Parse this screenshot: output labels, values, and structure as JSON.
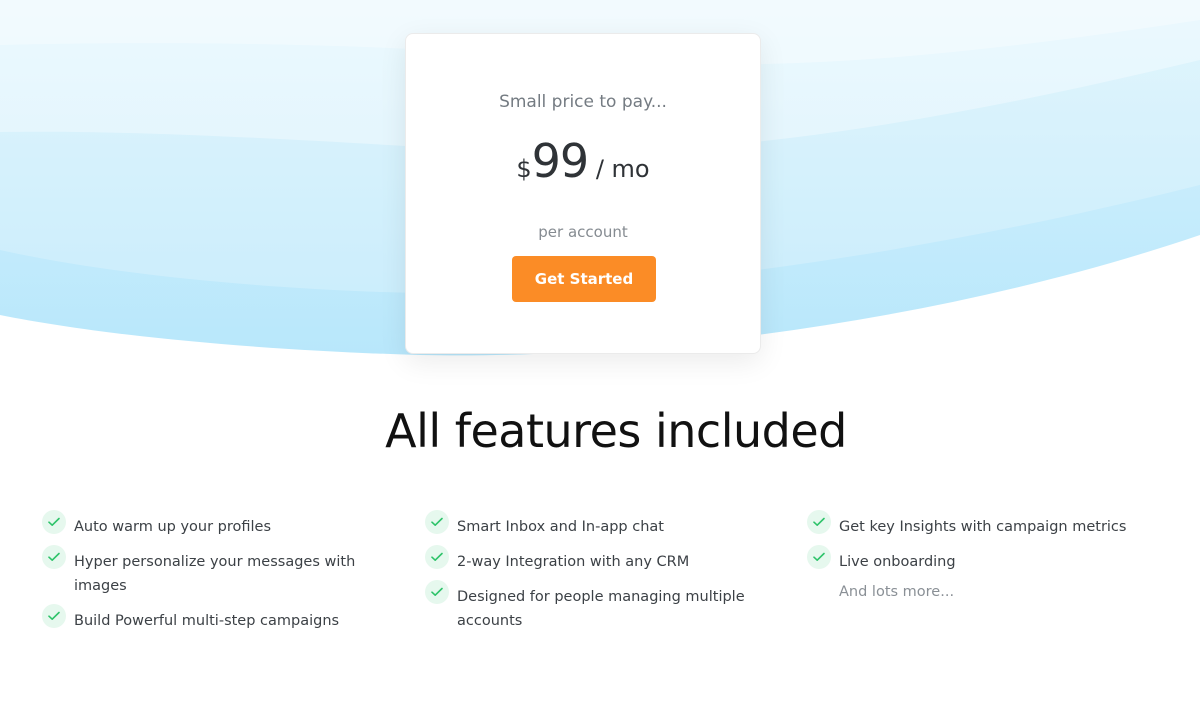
{
  "pricing": {
    "tagline": "Small price to pay...",
    "currency": "$",
    "amount": "99",
    "period": " / mo",
    "subtext": "per account",
    "cta_label": "Get Started"
  },
  "features": {
    "title": "All features included",
    "columns": [
      {
        "items": [
          {
            "label": "Auto warm up your profiles"
          },
          {
            "label": "Hyper personalize your messages with images"
          },
          {
            "label": "Build Powerful multi-step campaigns"
          }
        ]
      },
      {
        "items": [
          {
            "label": "Smart Inbox and In-app chat"
          },
          {
            "label": "2-way Integration with any CRM"
          },
          {
            "label": "Designed for people managing multiple accounts"
          }
        ]
      },
      {
        "items": [
          {
            "label": "Get key Insights with campaign metrics"
          },
          {
            "label": "Live onboarding"
          }
        ],
        "more_label": "And lots more..."
      }
    ]
  },
  "colors": {
    "accent": "#fb8c26",
    "check": "#2ec36a",
    "check_bg": "#e6f8ee",
    "wave": "#bfe9fb"
  },
  "icons": {
    "feature_bullet": "check-icon"
  }
}
